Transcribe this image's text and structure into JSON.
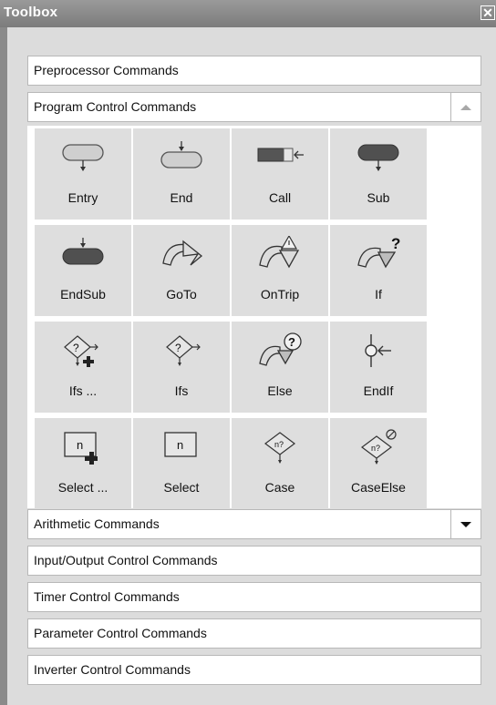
{
  "window": {
    "title": "Toolbox",
    "close_symbol": "✕"
  },
  "sections": [
    {
      "id": "preprocessor",
      "label": "Preprocessor Commands"
    },
    {
      "id": "program-control",
      "label": "Program Control Commands",
      "expanded": true,
      "button_icon": "up-arrow-icon"
    },
    {
      "id": "arithmetic",
      "label": "Arithmetic Commands",
      "button_icon": "down-arrow-icon"
    },
    {
      "id": "io-control",
      "label": "Input/Output Control Commands"
    },
    {
      "id": "timer-control",
      "label": "Timer Control Commands"
    },
    {
      "id": "parameter-control",
      "label": "Parameter Control Commands"
    },
    {
      "id": "inverter-control",
      "label": "Inverter Control Commands"
    }
  ],
  "tools": [
    {
      "label": "Entry",
      "icon": "entry-icon"
    },
    {
      "label": "End",
      "icon": "end-icon"
    },
    {
      "label": "Call",
      "icon": "call-icon"
    },
    {
      "label": "Sub",
      "icon": "sub-icon"
    },
    {
      "label": "EndSub",
      "icon": "endsub-icon"
    },
    {
      "label": "GoTo",
      "icon": "goto-icon"
    },
    {
      "label": "OnTrip",
      "icon": "ontrip-icon"
    },
    {
      "label": "If",
      "icon": "if-icon"
    },
    {
      "label": "Ifs ...",
      "icon": "ifs-add-icon"
    },
    {
      "label": "Ifs",
      "icon": "ifs-icon"
    },
    {
      "label": "Else",
      "icon": "else-icon"
    },
    {
      "label": "EndIf",
      "icon": "endif-icon"
    },
    {
      "label": "Select ...",
      "icon": "select-add-icon"
    },
    {
      "label": "Select",
      "icon": "select-icon"
    },
    {
      "label": "Case",
      "icon": "case-icon"
    },
    {
      "label": "CaseElse",
      "icon": "caseelse-icon"
    }
  ],
  "glyphs": {
    "q": "?",
    "n": "n",
    "n_q": "n?"
  }
}
